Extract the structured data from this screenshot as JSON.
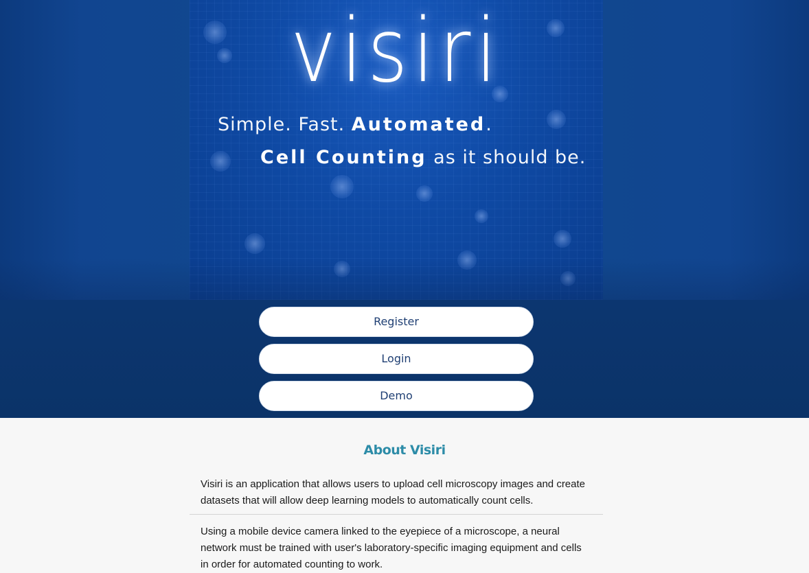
{
  "hero": {
    "logo_text": "visiri",
    "tagline_line1_light": "Simple. Fast. ",
    "tagline_line1_bold": "Automated",
    "tagline_line1_end": ".",
    "tagline_line2_bold": "Cell Counting",
    "tagline_line2_light": " as it should be."
  },
  "actions": {
    "register_label": "Register",
    "login_label": "Login",
    "demo_label": "Demo"
  },
  "about": {
    "title": "About Visiri",
    "paragraph_1": "Visiri is an application that allows users to upload cell microscopy images and create datasets that will allow deep learning models to automatically count cells.",
    "paragraph_2": "Using a mobile device camera linked to the eyepiece of a microscope, a neural network must be trained with user's laboratory-specific imaging equipment and cells in order for automated counting to work."
  },
  "colors": {
    "hero_blue": "#11478f",
    "action_band": "#0c3670",
    "about_title": "#2d8ca8",
    "button_text": "#1f3f73"
  }
}
